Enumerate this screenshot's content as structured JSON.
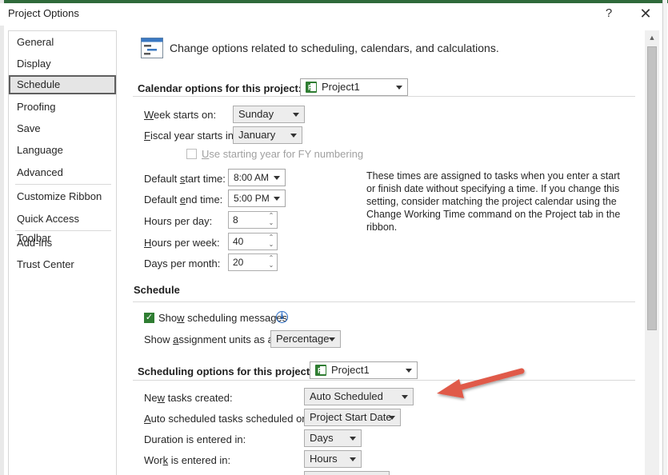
{
  "window": {
    "title": "Project Options",
    "help_label": "?",
    "close_label": "✕"
  },
  "nav": {
    "items": [
      {
        "label": "General"
      },
      {
        "label": "Display"
      },
      {
        "label": "Schedule",
        "selected": true
      },
      {
        "label": "Proofing"
      },
      {
        "label": "Save"
      },
      {
        "label": "Language"
      },
      {
        "label": "Advanced"
      },
      {
        "label": "Customize Ribbon"
      },
      {
        "label": "Quick Access Toolbar"
      },
      {
        "label": "Add-ins"
      },
      {
        "label": "Trust Center"
      }
    ]
  },
  "header": {
    "icon": "schedule-options-icon",
    "text": "Change options related to scheduling, calendars, and calculations."
  },
  "calendar": {
    "title": "Calendar options for this project:",
    "project_value": "Project1",
    "week_starts_label_u": "W",
    "week_starts_label": "eek starts on:",
    "week_starts_value": "Sunday",
    "fiscal_label_u": "F",
    "fiscal_label": "iscal year starts in:",
    "fiscal_value": "January",
    "use_fy_label_u": "U",
    "use_fy_label": "se starting year for FY numbering",
    "use_fy_checked": false,
    "start_time_label_a": "Default ",
    "start_time_label_u": "s",
    "start_time_label_b": "tart time:",
    "start_time_value": "8:00 AM",
    "end_time_label_a": "Default ",
    "end_time_label_u": "e",
    "end_time_label_b": "nd time:",
    "end_time_value": "5:00 PM",
    "hours_day_label": "Hours per day:",
    "hours_day_value": "8",
    "hours_week_label_u": "H",
    "hours_week_label": "ours per week:",
    "hours_week_value": "40",
    "days_month_label": "Days per month:",
    "days_month_value": "20",
    "note": "These times are assigned to tasks when you enter a start or finish date without specifying a time. If you change this setting, consider matching the project calendar using the Change Working Time command on the Project tab in the ribbon."
  },
  "schedule": {
    "title": "Schedule",
    "show_messages_label_a": "Sho",
    "show_messages_label_u": "w",
    "show_messages_label_b": " scheduling messages",
    "show_messages_checked": true,
    "assignment_label_a": "Show ",
    "assignment_label_u": "a",
    "assignment_label_b": "ssignment units as a:",
    "assignment_value": "Percentage"
  },
  "scheduling": {
    "title": "Scheduling options for this project:",
    "project_value": "Project1",
    "new_tasks_label_a": "Ne",
    "new_tasks_label_u": "w",
    "new_tasks_label_b": " tasks created:",
    "new_tasks_value": "Auto Scheduled",
    "auto_sched_label_u": "A",
    "auto_sched_label": "uto scheduled tasks scheduled on:",
    "auto_sched_value": "Project Start Date",
    "duration_label_a": "Duration is entered in:",
    "duration_value": "Days",
    "work_label_a": "Wor",
    "work_label_u": "k",
    "work_label_b": " is entered in:",
    "work_value": "Hours"
  },
  "colors": {
    "accent_green": "#2f7d32",
    "arrow_red": "#e05a4a",
    "info_blue": "#2b6cc4"
  }
}
